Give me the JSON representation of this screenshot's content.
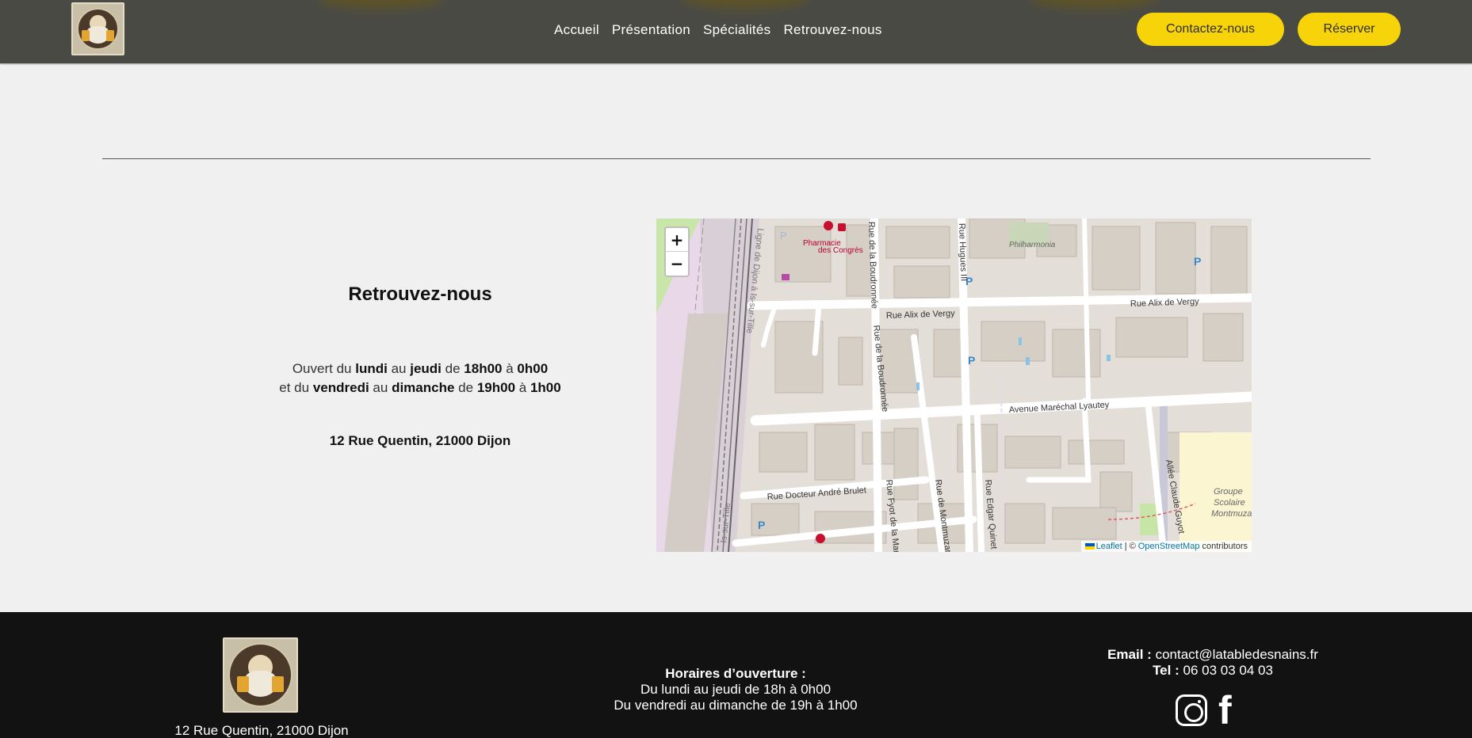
{
  "header": {
    "nav": [
      {
        "label": "Accueil"
      },
      {
        "label": "Présentation"
      },
      {
        "label": "Spécialités"
      },
      {
        "label": "Retrouvez-nous"
      }
    ],
    "contact_button": "Contactez-nous",
    "reserve_button": "Réserver",
    "accent_color": "#f7d40a"
  },
  "section": {
    "title": "Retrouvez-nous",
    "hours_line1": {
      "prefix": "Ouvert du",
      "day_from": "lundi",
      "to_word": "au",
      "day_to": "jeudi",
      "from_word": "de",
      "time_from": "18h00",
      "a_word": "à",
      "time_to": "0h00"
    },
    "hours_line2": {
      "prefix": "et du",
      "day_from": "vendredi",
      "to_word": "au",
      "day_to": "dimanche",
      "from_word": "de",
      "time_from": "19h00",
      "a_word": "à",
      "time_to": "1h00"
    },
    "address": "12 Rue Quentin, 21000 Dijon"
  },
  "map": {
    "zoom_in": "+",
    "zoom_out": "−",
    "attribution": {
      "leaflet": "Leaflet",
      "sep": "| ©",
      "osm": "OpenStreetMap",
      "suffix": "contributors"
    },
    "labels": {
      "pharmacie": "Pharmacie",
      "pharmacie2": "des Congrès",
      "philharmonia": "Philharmonia",
      "rue_alix_1": "Rue Alix de Vergy",
      "rue_alix_2": "Rue Alix de Vergy",
      "avenue": "Avenue Maréchal Lyautey",
      "rue_brulet": "Rue Docteur André Brulet",
      "rue_bourdonnee_1": "Rue de la Boudronnée",
      "rue_bourdonnee_2": "Rue de la Boudronnée",
      "rue_hugues": "Rue Hugues III",
      "rue_fyot": "Rue Fyot de la Mar",
      "rue_montmuzard": "Rue de Montmuzard",
      "rue_quinet": "Rue Edgar Quinet",
      "allee": "Allée Claude Guyot",
      "ligne": "Ligne de Dijon à Is-sur-Tille",
      "groupe1": "Groupe",
      "groupe2": "Scolaire",
      "groupe3": "Montmuzard",
      "sur_tille": "Is-sur-Tille"
    }
  },
  "footer": {
    "address": "12 Rue Quentin, 21000 Dijon",
    "hours_title": "Horaires d’ouverture :",
    "hours_1": "Du lundi au jeudi de 18h à 0h00",
    "hours_2": "Du vendredi au dimanche de 19h à 1h00",
    "email_label": "Email :",
    "email": "contact@latabledesnains.fr",
    "tel_label": "Tel :",
    "tel": "06 03 03 04 03",
    "social": [
      "instagram-icon",
      "facebook-icon"
    ]
  }
}
